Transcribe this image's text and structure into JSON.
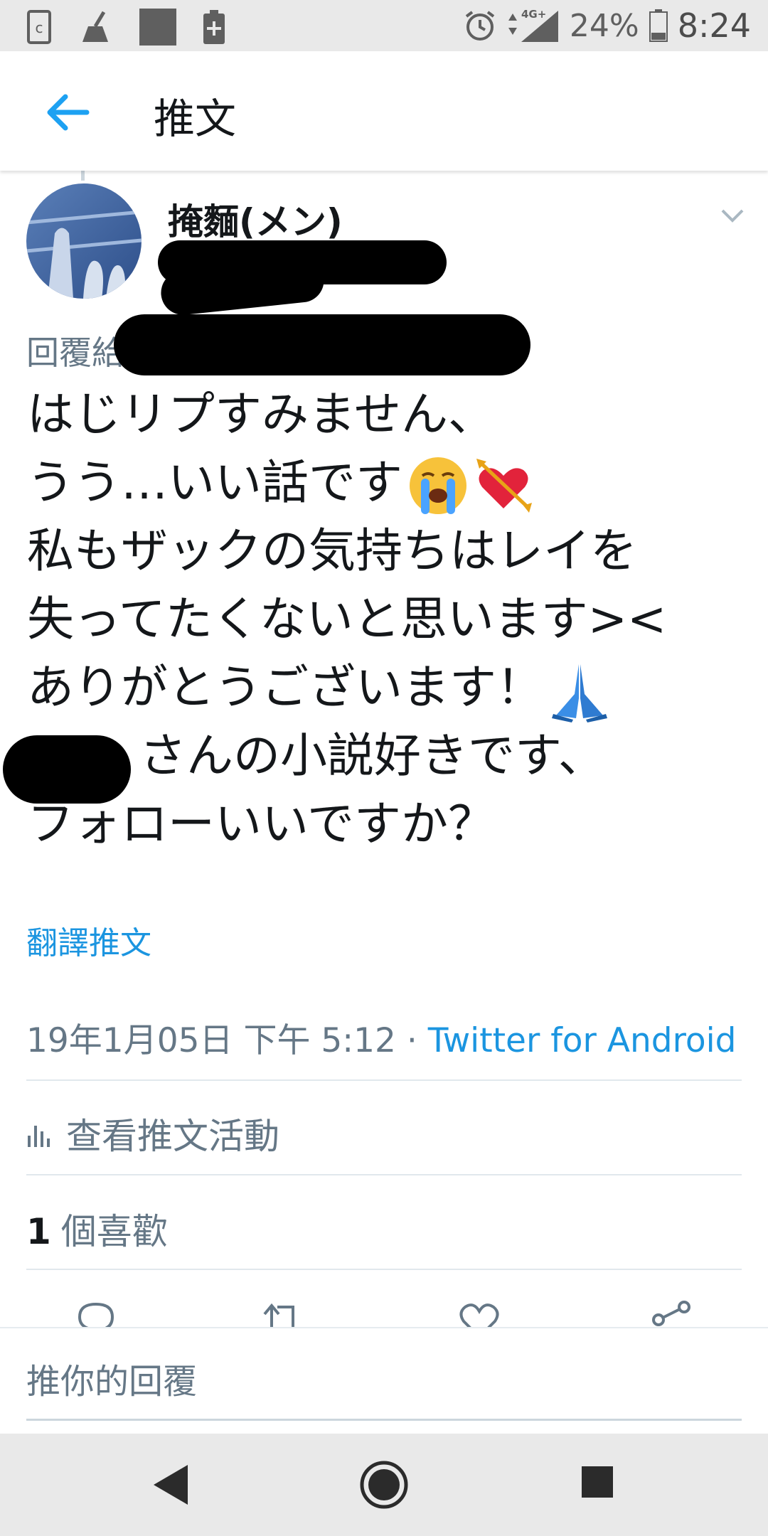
{
  "status_bar": {
    "network": "4G+",
    "battery_percent": "24%",
    "time": "8:24"
  },
  "app_bar": {
    "title": "推文"
  },
  "tweet": {
    "author_name": "掩麵(メン)",
    "reply_to_prefix": "回覆給",
    "lines": [
      "はじリプすみません、",
      "うう…いい話です",
      "私もザックの気持ちはレイを",
      "失ってたくないと思います><",
      "ありがとうございます！",
      "さんの小説好きです、",
      "フォローいいですか？"
    ],
    "emojis": [
      "loudly-crying-face",
      "heart-with-arrow",
      "folded-hands"
    ],
    "translate_label": "翻譯推文",
    "date": "19年1月05日 下午 5:12",
    "separator": " · ",
    "source": "Twitter for Android",
    "activity_label": "查看推文活動",
    "like_count": "1",
    "like_label": "個喜歡"
  },
  "composer": {
    "placeholder": "推你的回覆"
  },
  "colors": {
    "accent": "#1b95e0",
    "secondary_text": "#657786",
    "primary_text": "#14171a"
  }
}
